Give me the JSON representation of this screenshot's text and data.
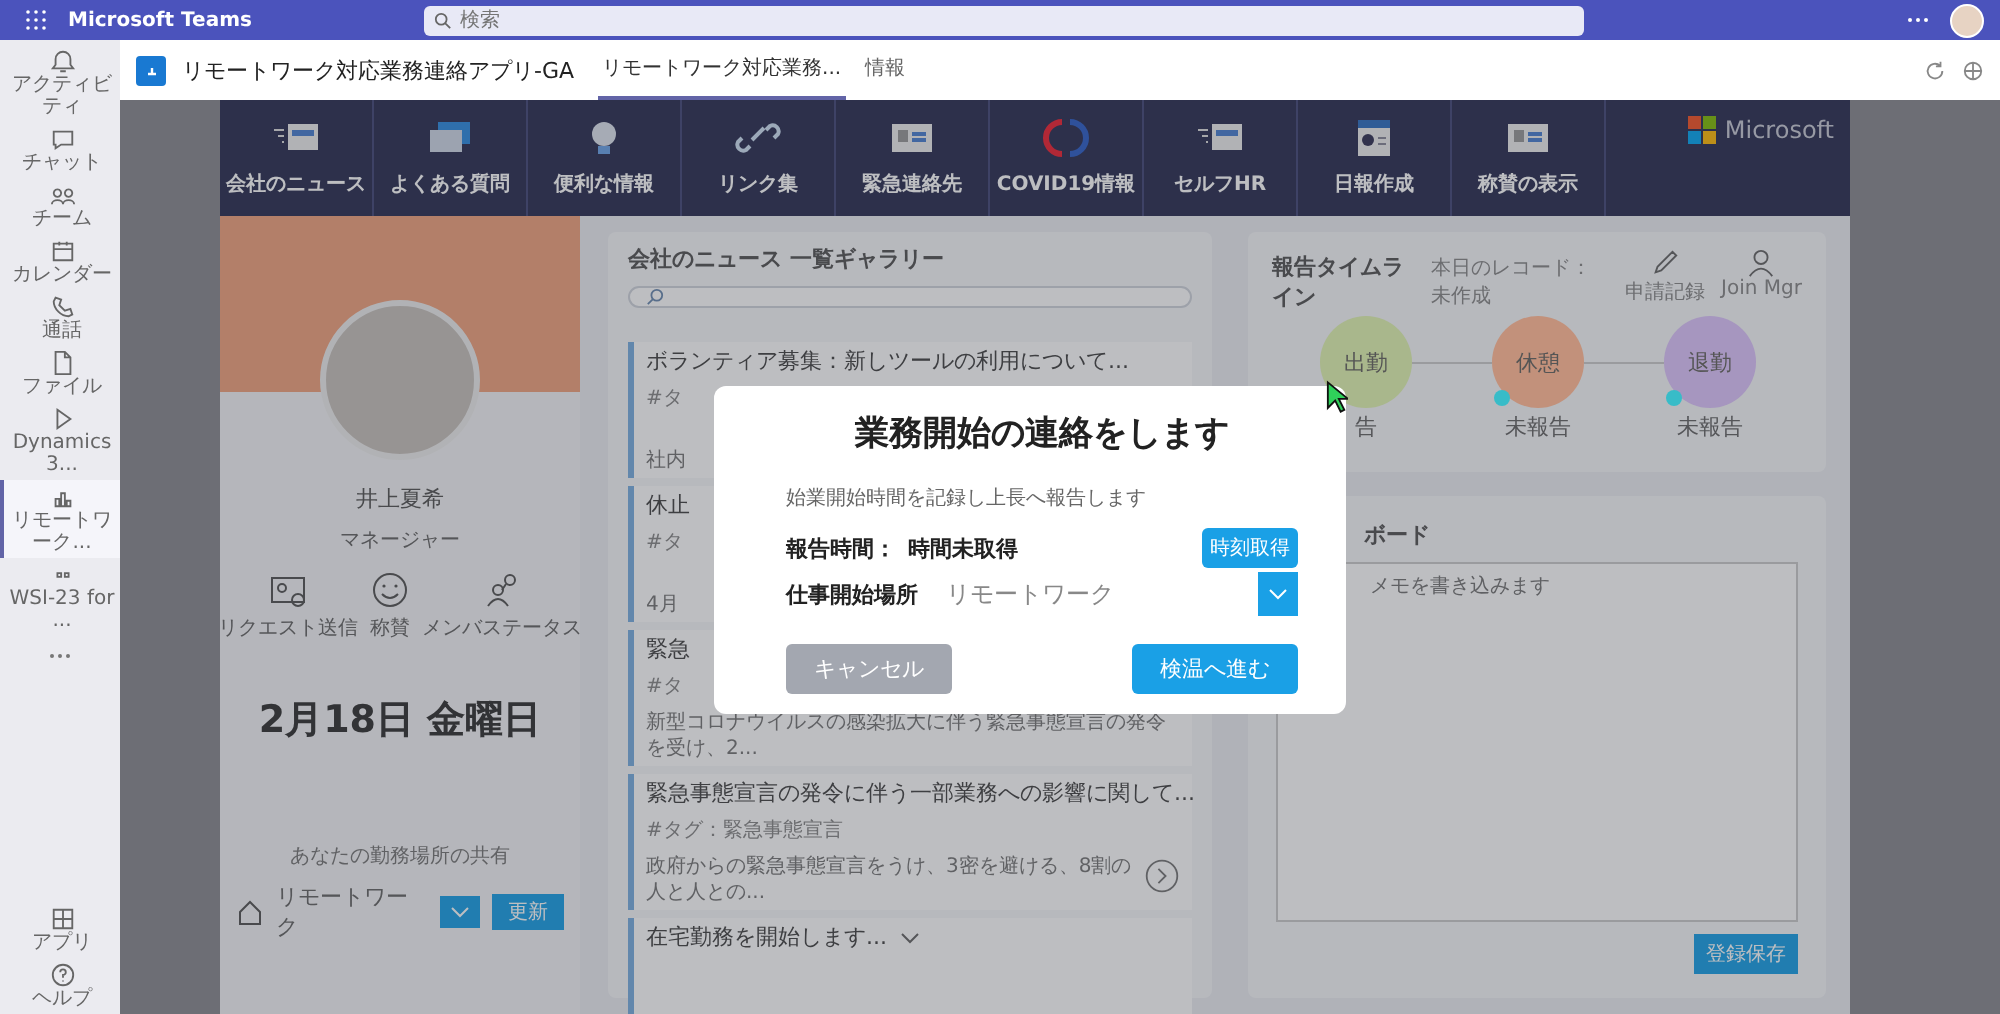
{
  "app_bar": {
    "title": "Microsoft Teams",
    "search": {
      "placeholder": "検索"
    }
  },
  "rail": {
    "items": [
      {
        "label": "アクティビティ",
        "selected": false
      },
      {
        "label": "チャット",
        "selected": false
      },
      {
        "label": "チーム",
        "selected": false
      },
      {
        "label": "カレンダー",
        "selected": false
      },
      {
        "label": "通話",
        "selected": false
      },
      {
        "label": "ファイル",
        "selected": false
      },
      {
        "label": "Dynamics 3...",
        "selected": false
      },
      {
        "label": "リモートワーク...",
        "selected": true
      },
      {
        "label": "WSI-23 for ...",
        "selected": false
      }
    ],
    "bottom_items": [
      {
        "label": "アプリ"
      },
      {
        "label": "ヘルプ"
      }
    ]
  },
  "app_header": {
    "title": "リモートワーク対応業務連絡アプリ-GA",
    "tabs": [
      {
        "label": "リモートワーク対応業務...",
        "selected": true
      },
      {
        "label": "情報",
        "selected": false
      }
    ]
  },
  "nav": {
    "items": [
      "会社のニュース",
      "よくある質問",
      "便利な情報",
      "リンク集",
      "緊急連絡先",
      "COVID19情報",
      "セルフHR",
      "日報作成",
      "称賛の表示"
    ],
    "brand": "Microsoft"
  },
  "profile": {
    "name": "井上夏希",
    "role": "マネージャー",
    "actions": [
      "リクエスト送信",
      "称賛",
      "メンバステータス"
    ],
    "date": "2月18日 金曜日",
    "location_caption": "あなたの勤務場所の共有",
    "location": "リモートワーク",
    "update_button": "更新"
  },
  "news": {
    "title": "会社のニュース 一覧ギャラリー",
    "items": [
      {
        "title": "ボランティア募集：新しツールの利用について...",
        "tag": "#タ",
        "summary": "社内"
      },
      {
        "title": "休止",
        "tag": "#タ",
        "summary": "4月"
      },
      {
        "title": "緊急",
        "tag": "#タ",
        "summary": "新型コロナウイルスの感染拡大に伴う緊急事態宣言の発令を受け、2..."
      },
      {
        "title": "緊急事態宣言の発令に伴う一部業務への影響に関して...",
        "tag": "#タグ：緊急事態宣言",
        "summary": "政府からの緊急事態宣言をうけ、3密を避ける、8割の人と人との..."
      },
      {
        "title": "在宅勤務を開始します..."
      }
    ]
  },
  "timeline": {
    "title": "報告タイムライン",
    "record": "本日のレコード：未作成",
    "actions": [
      "申請記録",
      "Join Mgr"
    ],
    "steps": [
      {
        "label": "出勤",
        "status": "告",
        "color": "#a9b78c",
        "dot": false
      },
      {
        "label": "休憩",
        "status": "未報告",
        "color": "#c2917b",
        "dot": true
      },
      {
        "label": "退勤",
        "status": "未報告",
        "color": "#a696bf",
        "dot": true
      }
    ]
  },
  "board": {
    "title": "ボード",
    "placeholder": "メモを書き込みます",
    "button": "登録保存"
  },
  "dialog": {
    "title": "業務開始の連絡をします",
    "subtitle": "始業開始時間を記録し上長へ報告します",
    "report_label": "報告時間：",
    "report_value": "時間未取得",
    "time_button": "時刻取得",
    "place_label": "仕事開始場所",
    "place_value": "リモートワーク",
    "cancel": {
      "label": "キャンセル",
      "disabled": true
    },
    "proceed": {
      "label": "検温へ進む",
      "disabled": false
    }
  }
}
